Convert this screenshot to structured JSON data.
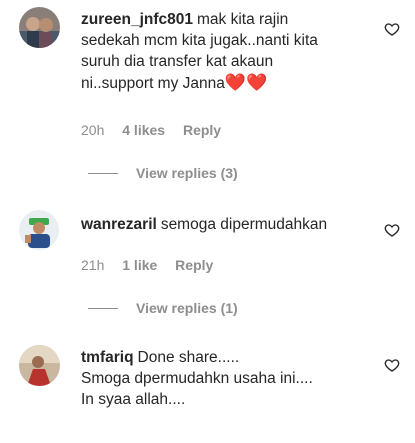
{
  "comments": [
    {
      "username": "zureen_jnfc801",
      "lines": [
        "mak kita rajin",
        "sedekah mcm kita jugak..nanti kita",
        "suruh dia transfer kat akaun",
        "ni..support my Janna"
      ],
      "emoji": "❤️❤️",
      "time": "20h",
      "likes": "4 likes",
      "reply": "Reply",
      "view_replies": "View replies (3)"
    },
    {
      "username": "wanrezaril",
      "lines": [
        "semoga dipermudahkan"
      ],
      "time": "21h",
      "likes": "1 like",
      "reply": "Reply",
      "view_replies": "View replies (1)"
    },
    {
      "username": "tmfariq",
      "lines": [
        "Done share.....",
        "Smoga dpermudahkn usaha ini....",
        "In syaa allah...."
      ]
    }
  ],
  "icons": {
    "like": "heart-outline-icon"
  },
  "colors": {
    "text": "#262626",
    "muted": "#8e8e8e",
    "heart": "#e0245e"
  }
}
